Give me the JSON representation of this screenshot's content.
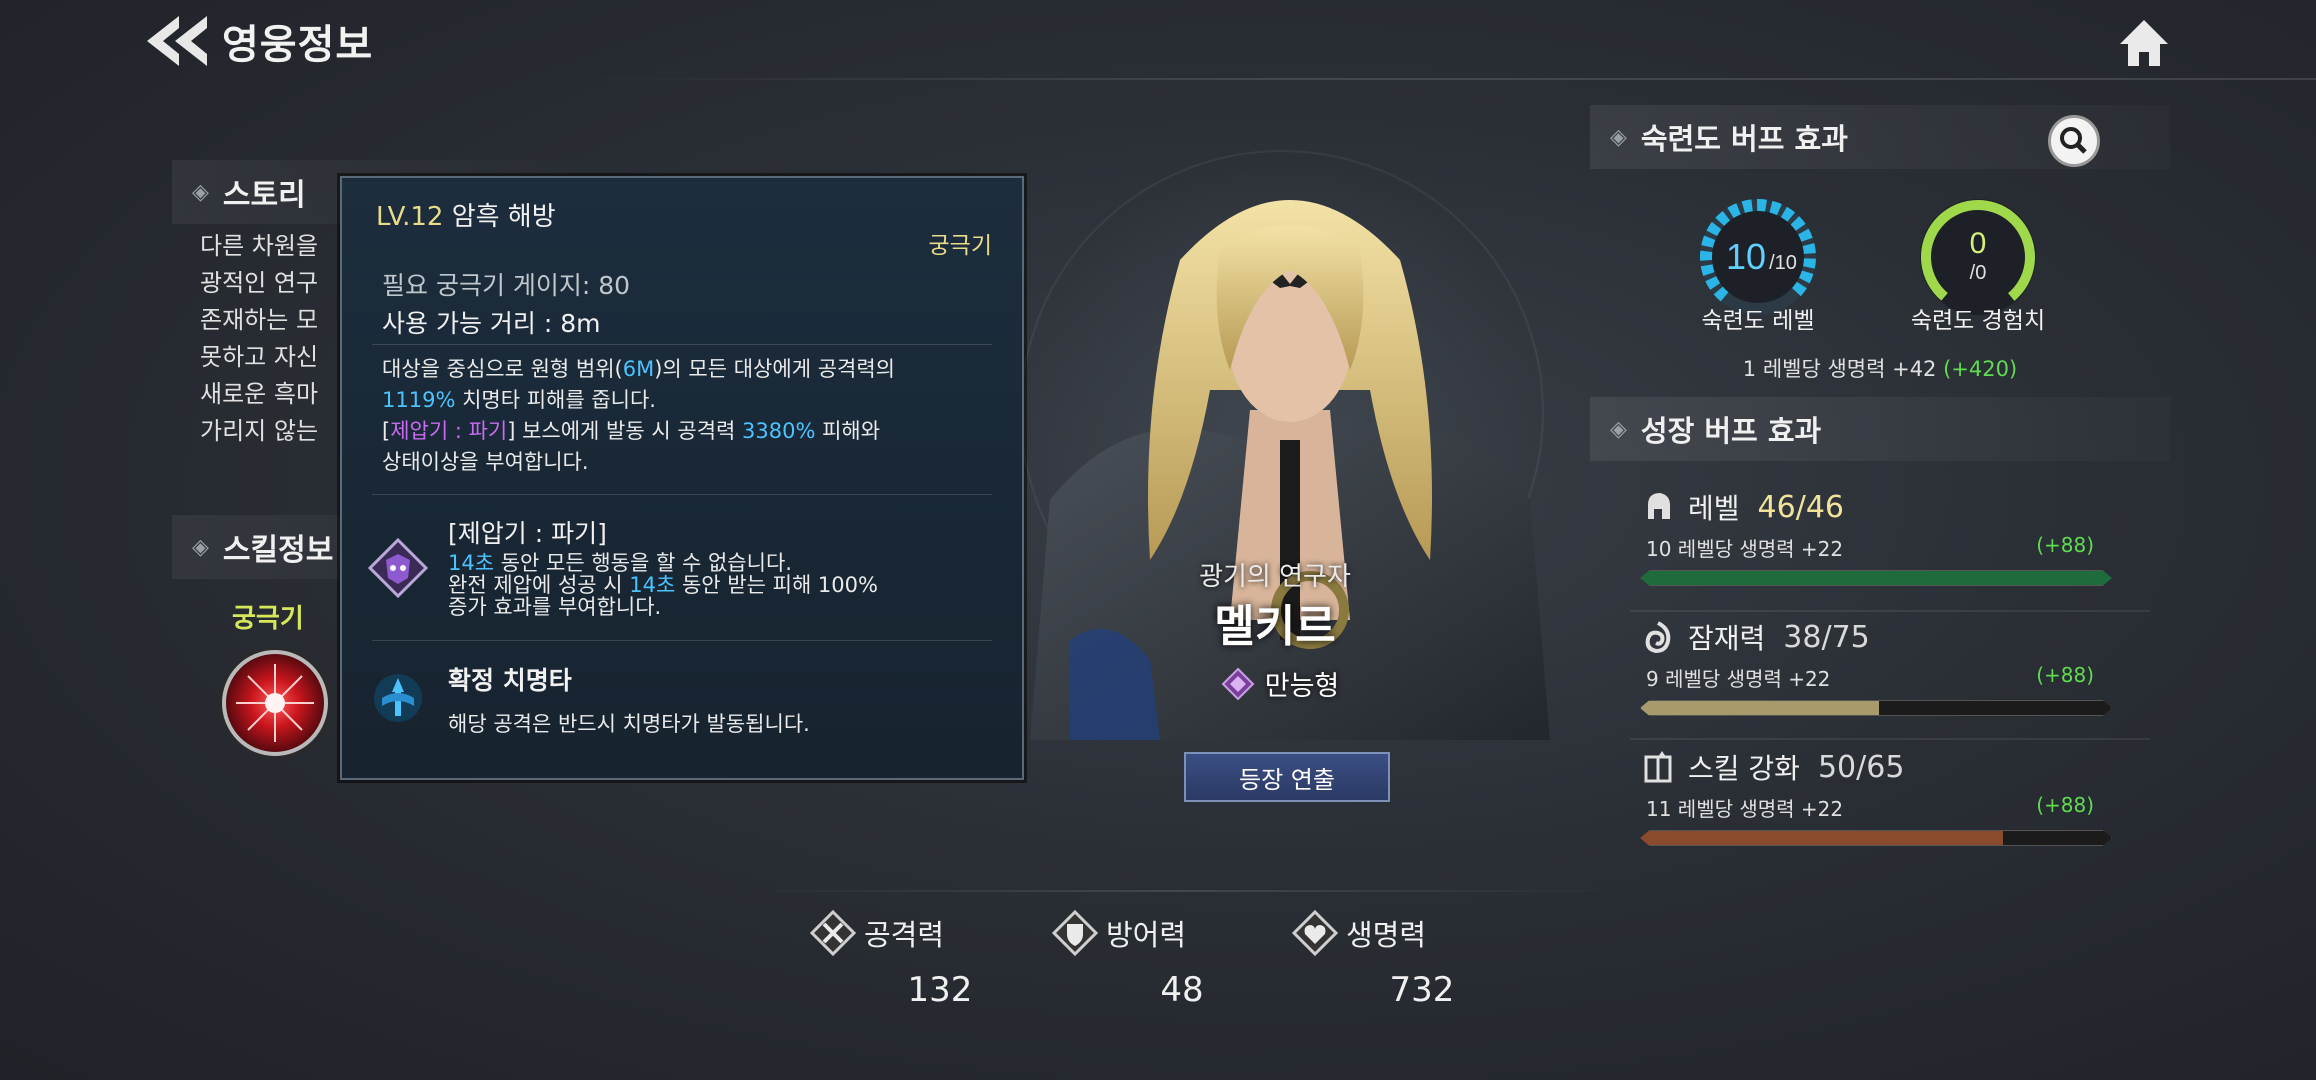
{
  "header": {
    "title": "영웅정보"
  },
  "story": {
    "title": "스토리",
    "lines": [
      "다른 차원을",
      "광적인 연구",
      "존재하는 모",
      "못하고 자신",
      "새로운 흑마",
      "가리지 않는"
    ]
  },
  "skill": {
    "title": "스킬정보",
    "tab_ult": "궁극기"
  },
  "tooltip": {
    "level": "LV.12",
    "name": "암흑 해방",
    "type": "궁극기",
    "gauge": "필요 궁극기 게이지: 80",
    "range_label": "사용 가능 거리 :",
    "range_value": "8m",
    "desc1_a": "대상을 중심으로 원형 범위(",
    "desc1_b": "6M",
    "desc1_c": ")의 모든 대상에게 공격력의",
    "desc2_a": "1119%",
    "desc2_b": " 치명타 피해를 줍니다.",
    "desc3_a": "[",
    "desc3_b": "제압기 : 파기",
    "desc3_c": "] 보스에게 발동 시 공격력 ",
    "desc3_d": "3380%",
    "desc3_e": " 피해와",
    "desc4": "상태이상을 부여합니다.",
    "feature1_title": "[제압기 : 파기]",
    "feature1_l1_a": "14초",
    "feature1_l1_b": " 동안 모든 행동을 할 수 없습니다.",
    "feature1_l2_a": "완전 제압에 성공 시 ",
    "feature1_l2_b": "14초",
    "feature1_l2_c": " 동안 받는 피해 100%",
    "feature1_l3": "증가 효과를 부여합니다.",
    "feature2_title": "확정 치명타",
    "feature2_desc": "해당 공격은 반드시 치명타가 발동됩니다."
  },
  "hero": {
    "subtitle": "광기의 연구자",
    "name": "멜키르",
    "class": "만능형",
    "intro_button": "등장 연출"
  },
  "stats": {
    "attack_label": "공격력",
    "attack_value": "132",
    "defense_label": "방어력",
    "defense_value": "48",
    "hp_label": "생명력",
    "hp_value": "732"
  },
  "mastery": {
    "title": "숙련도 버프 효과",
    "level_value": "10",
    "level_max": "/10",
    "level_fraction": 1.0,
    "level_label": "숙련도 레벨",
    "exp_value": "0",
    "exp_max": "/0",
    "exp_fraction": 1.0,
    "exp_label": "숙련도 경험치",
    "bonus_text": "1 레벨당 생명력 +42",
    "bonus_total": "(+420)"
  },
  "growth": {
    "title": "성장 버프 효과",
    "items": [
      {
        "name": "레벨",
        "current": "46",
        "max": "46",
        "value_text": "46/46",
        "desc": "10 레벨당 생명력 +22",
        "bonus": "(+88)",
        "fraction": 1.0,
        "color": "#1e6b3c",
        "value_color": "#f1e49a"
      },
      {
        "name": "잠재력",
        "current": "38",
        "max": "75",
        "value_text": "38/75",
        "desc": "9 레벨당 생명력 +22",
        "bonus": "(+88)",
        "fraction": 0.5067,
        "color": "#a89a6a",
        "value_color": "#d9d9d9"
      },
      {
        "name": "스킬 강화",
        "current": "50",
        "max": "65",
        "value_text": "50/65",
        "desc": "11 레벨당 생명력 +22",
        "bonus": "(+88)",
        "fraction": 0.7692,
        "color": "#8a4a2c",
        "value_color": "#d9d9d9"
      }
    ]
  }
}
